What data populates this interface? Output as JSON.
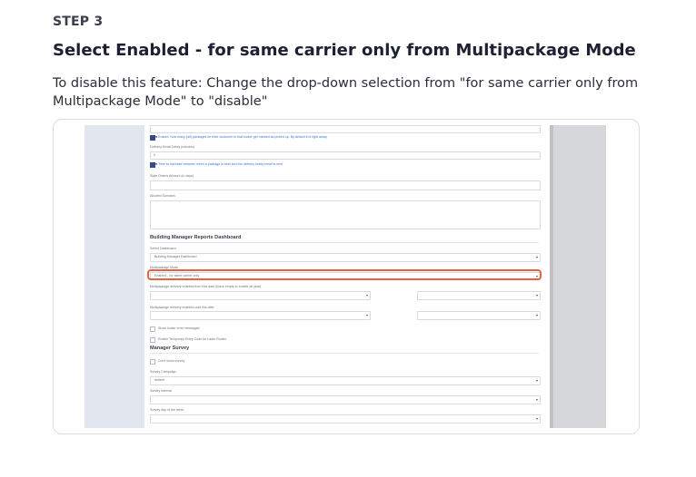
{
  "step": {
    "label": "STEP 3",
    "title": "Select Enabled - for same carrier only from Multipackage Mode",
    "description": "To disable this feature: Change the drop-down selection from \"for same carrier only from Multipackage Mode\" to \"disable\""
  },
  "screenshot": {
    "email_hint": "■ Ensure, how many (all) packages for their customer in that locker get marked as picked up. By default it is right away.",
    "delivery_delay_label": "Delivery Email Delay (minutes)",
    "delivery_delay_value": "0",
    "delay_hint": "■ Time to increase between when a package is held and the delivery ready email is sent",
    "stale_orders_label": "Stale Orders Amount (in days)",
    "allowed_domains_label": "Allowed Domains",
    "reports_section": "Building Manager Reports Dashboard",
    "select_dashboard_label": "Select Dashboard",
    "select_dashboard_value": "Building Manager Dashboard",
    "multipackage_mode_label": "Multipackage Mode",
    "multipackage_mode_value": "Enabled - for same carrier only",
    "mp_from_label": "Multipackage delivery enabled from this date (leave empty to enable all year)",
    "mp_until_label": "Multipackage delivery enabled until this date",
    "show_errors_label": "Show locker error messages",
    "temp_entry_label": "Enable Temporary Entry Code for Laser Router",
    "survey_section": "Manager Survey",
    "dont_show_survey_label": "Don't show survey",
    "survey_campaign_label": "Survey Campaign",
    "survey_campaign_value": "default",
    "survey_interval_label": "Survey interval",
    "survey_day_label": "Survey day of the week"
  },
  "colors": {
    "highlight": "#e8623f",
    "checkbox_fill": "#3a4a86",
    "link": "#3b74d8"
  }
}
